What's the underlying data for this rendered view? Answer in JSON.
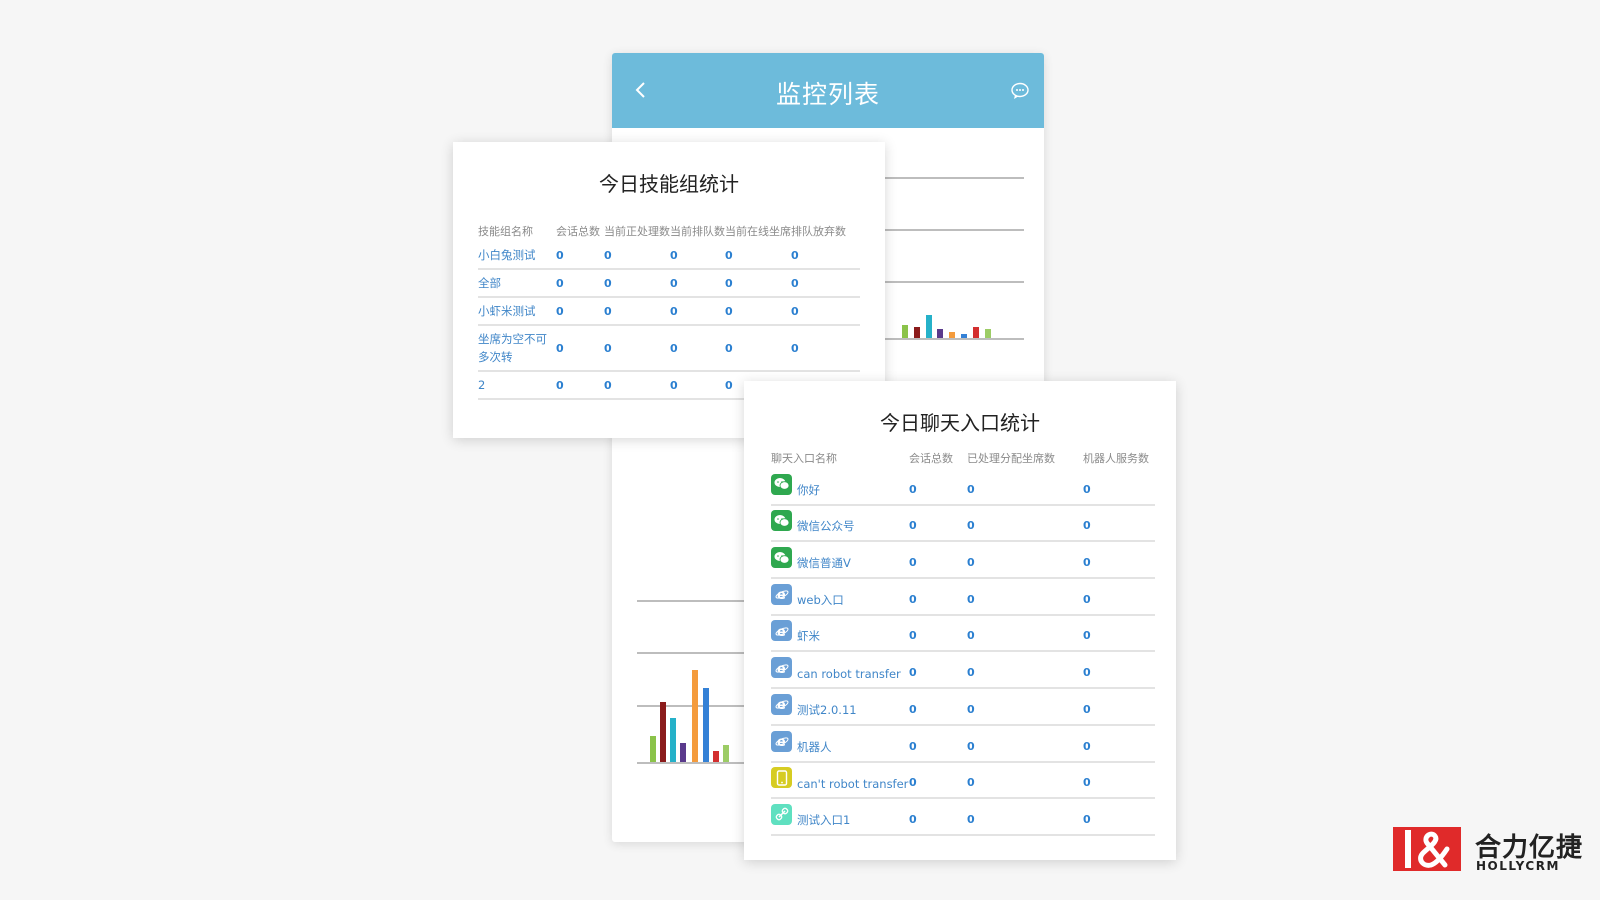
{
  "phone": {
    "title": "监控列表",
    "icons": {
      "back": "chevron-left-icon",
      "chat": "chat-bubble-icon",
      "color": "#6dbbdb"
    }
  },
  "skill_card": {
    "title": "今日技能组统计",
    "headers": [
      "技能组名称",
      "会话总数",
      "当前正处理数",
      "当前排队数",
      "当前在线坐席",
      "排队放弃数"
    ],
    "rows": [
      {
        "name": "小白兔测试",
        "values": [
          "0",
          "0",
          "0",
          "0",
          "0"
        ]
      },
      {
        "name": "全部",
        "values": [
          "0",
          "0",
          "0",
          "0",
          "0"
        ]
      },
      {
        "name": "小虾米测试",
        "values": [
          "0",
          "0",
          "0",
          "0",
          "0"
        ]
      },
      {
        "name": "坐席为空不可多次转",
        "values": [
          "0",
          "0",
          "0",
          "0",
          "0"
        ]
      },
      {
        "name": "2",
        "values": [
          "0",
          "0",
          "0",
          "0"
        ]
      }
    ]
  },
  "entry_card": {
    "title": "今日聊天入口统计",
    "headers": [
      "聊天入口名称",
      "会话总数",
      "已处理分配坐席数",
      "机器人服务数"
    ],
    "rows": [
      {
        "name": "你好",
        "icon": "wechat-icon",
        "values": [
          "0",
          "0",
          "0"
        ]
      },
      {
        "name": "微信公众号",
        "icon": "wechat-icon",
        "values": [
          "0",
          "0",
          "0"
        ]
      },
      {
        "name": "微信普通V",
        "icon": "wechat-icon",
        "values": [
          "0",
          "0",
          "0"
        ]
      },
      {
        "name": "web入口",
        "icon": "browser-icon",
        "values": [
          "0",
          "0",
          "0"
        ]
      },
      {
        "name": "虾米",
        "icon": "browser-icon",
        "values": [
          "0",
          "0",
          "0"
        ]
      },
      {
        "name": "can robot transfer",
        "icon": "browser-icon",
        "values": [
          "0",
          "0",
          "0"
        ]
      },
      {
        "name": "测试2.0.11",
        "icon": "browser-icon",
        "values": [
          "0",
          "0",
          "0"
        ]
      },
      {
        "name": "机器人",
        "icon": "browser-icon",
        "values": [
          "0",
          "0",
          "0"
        ]
      },
      {
        "name": "can't robot transfer",
        "icon": "mobile-icon",
        "values": [
          "0",
          "0",
          "0"
        ]
      },
      {
        "name": "测试入口1",
        "icon": "link-icon",
        "values": [
          "0",
          "0",
          "0"
        ]
      }
    ],
    "icon_colors": {
      "wechat-icon": "#2fa84f",
      "browser-icon": "#6a9fd6",
      "mobile-icon": "#d6cc22",
      "link-icon": "#5fe0c0"
    }
  },
  "logo": {
    "cn": "合力亿捷",
    "en": "HOLLYCRM",
    "color": "#e02a2a"
  }
}
